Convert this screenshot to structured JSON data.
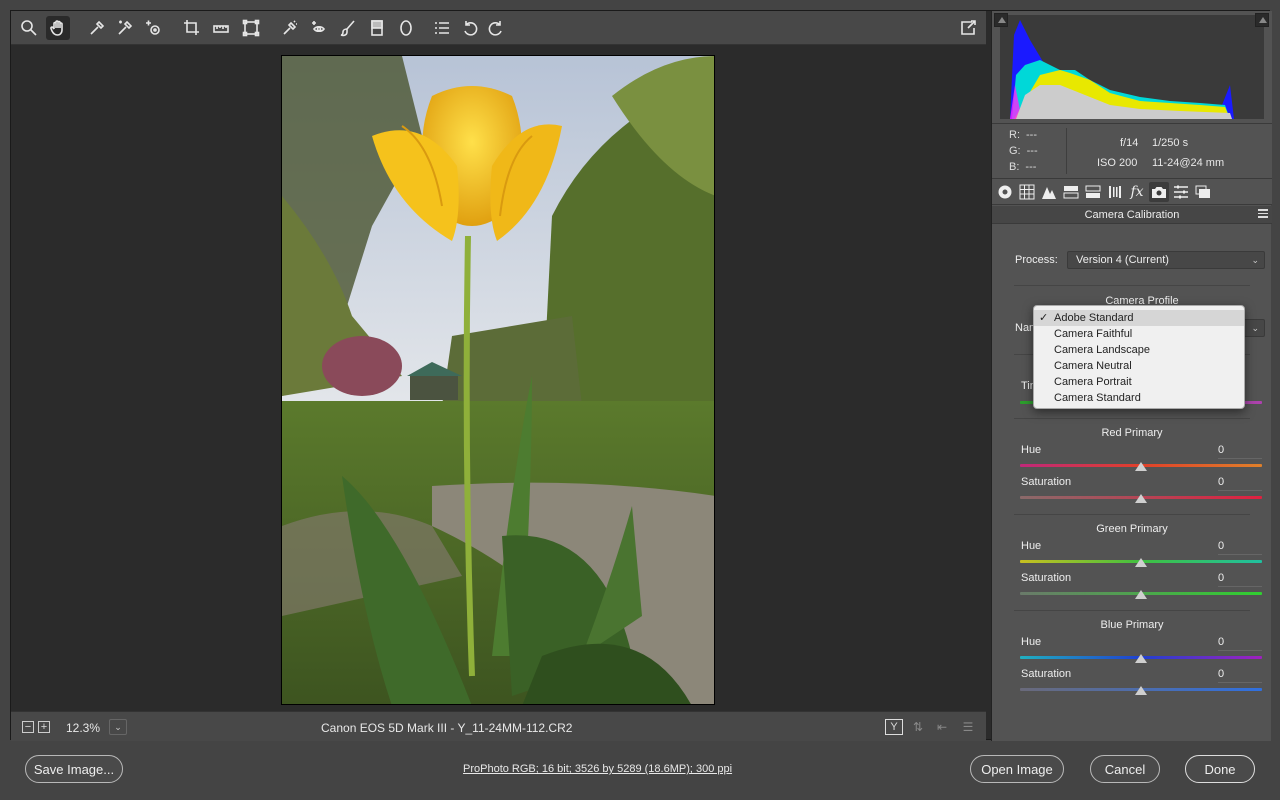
{
  "toolbar": {
    "tools": [
      "zoom-tool",
      "hand-tool",
      "white-balance-tool",
      "color-sampler-tool",
      "targeted-adjustment-tool",
      "crop-tool",
      "straighten-tool",
      "transform-tool",
      "spot-removal-tool",
      "red-eye-tool",
      "adjustment-brush-tool",
      "graduated-filter-tool",
      "radial-filter-tool",
      "preferences-list-icon",
      "rotate-left-tool",
      "rotate-right-tool"
    ],
    "active": "hand-tool"
  },
  "histogram": {
    "readout": {
      "r_label": "R:",
      "r_value": "---",
      "g_label": "G:",
      "g_value": "---",
      "b_label": "B:",
      "b_value": "---"
    },
    "exif": {
      "aperture": "f/14",
      "shutter": "1/250 s",
      "iso": "ISO 200",
      "lens": "11-24@24 mm"
    }
  },
  "panel": {
    "title": "Camera Calibration",
    "process_label": "Process:",
    "process_value": "Version 4 (Current)",
    "camera_profile_title": "Camera Profile",
    "name_label": "Name",
    "tint_label": "Tint",
    "profile_options": [
      "Adobe Standard",
      "Camera Faithful",
      "Camera Landscape",
      "Camera Neutral",
      "Camera Portrait",
      "Camera Standard"
    ],
    "profile_selected": "Adobe Standard",
    "red": {
      "title": "Red Primary",
      "hue_label": "Hue",
      "hue_value": "0",
      "sat_label": "Saturation",
      "sat_value": "0"
    },
    "green": {
      "title": "Green Primary",
      "hue_label": "Hue",
      "hue_value": "0",
      "sat_label": "Saturation",
      "sat_value": "0"
    },
    "blue": {
      "title": "Blue Primary",
      "hue_label": "Hue",
      "hue_value": "0",
      "sat_label": "Saturation",
      "sat_value": "0"
    }
  },
  "status": {
    "zoom_out": "−",
    "zoom_in": "+",
    "zoom": "12.3%",
    "filename": "Canon EOS 5D Mark III  -  Y_11-24MM-112.CR2"
  },
  "bottom": {
    "save_image": "Save Image...",
    "workflow": "ProPhoto RGB; 16 bit; 3526 by 5289 (18.6MP); 300 ppi",
    "open_image": "Open Image",
    "cancel": "Cancel",
    "done": "Done"
  },
  "colors": {
    "panel_bg": "#535353",
    "preview_bg": "#2b2b2b",
    "toolbar_bg": "#484848"
  }
}
